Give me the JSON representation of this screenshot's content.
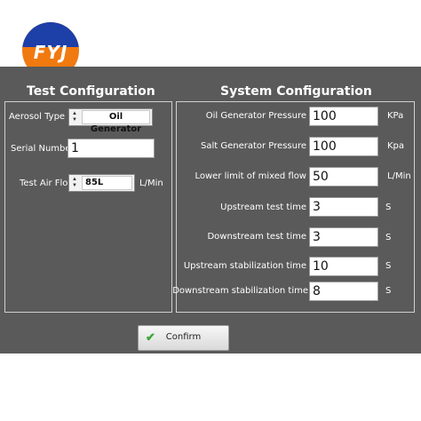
{
  "logo": {
    "text": "FYJ"
  },
  "test_config": {
    "title": "Test Configuration",
    "aerosol_type": {
      "label": "Aerosol Type",
      "value": "Oil Generator"
    },
    "serial_number": {
      "label": "Serial Number",
      "value": "1"
    },
    "test_air_flow": {
      "label": "Test Air Flow",
      "value": "85L",
      "unit": "L/Min"
    }
  },
  "system_config": {
    "title": "System Configuration",
    "fields": [
      {
        "label": "Oil Generator Pressure",
        "value": "100",
        "unit": "KPa"
      },
      {
        "label": "Salt Generator Pressure",
        "value": "100",
        "unit": "Kpa"
      },
      {
        "label": "Lower limit of mixed flow",
        "value": "50",
        "unit": "L/Min"
      },
      {
        "label": "Upstream test time",
        "value": "3",
        "unit": "S"
      },
      {
        "label": "Downstream test time",
        "value": "3",
        "unit": "S"
      },
      {
        "label": "Upstream stabilization time",
        "value": "10",
        "unit": "S"
      },
      {
        "label": "Downstream stabilization time",
        "value": "8",
        "unit": "S"
      }
    ]
  },
  "confirm_button": {
    "label": "Confirm"
  }
}
